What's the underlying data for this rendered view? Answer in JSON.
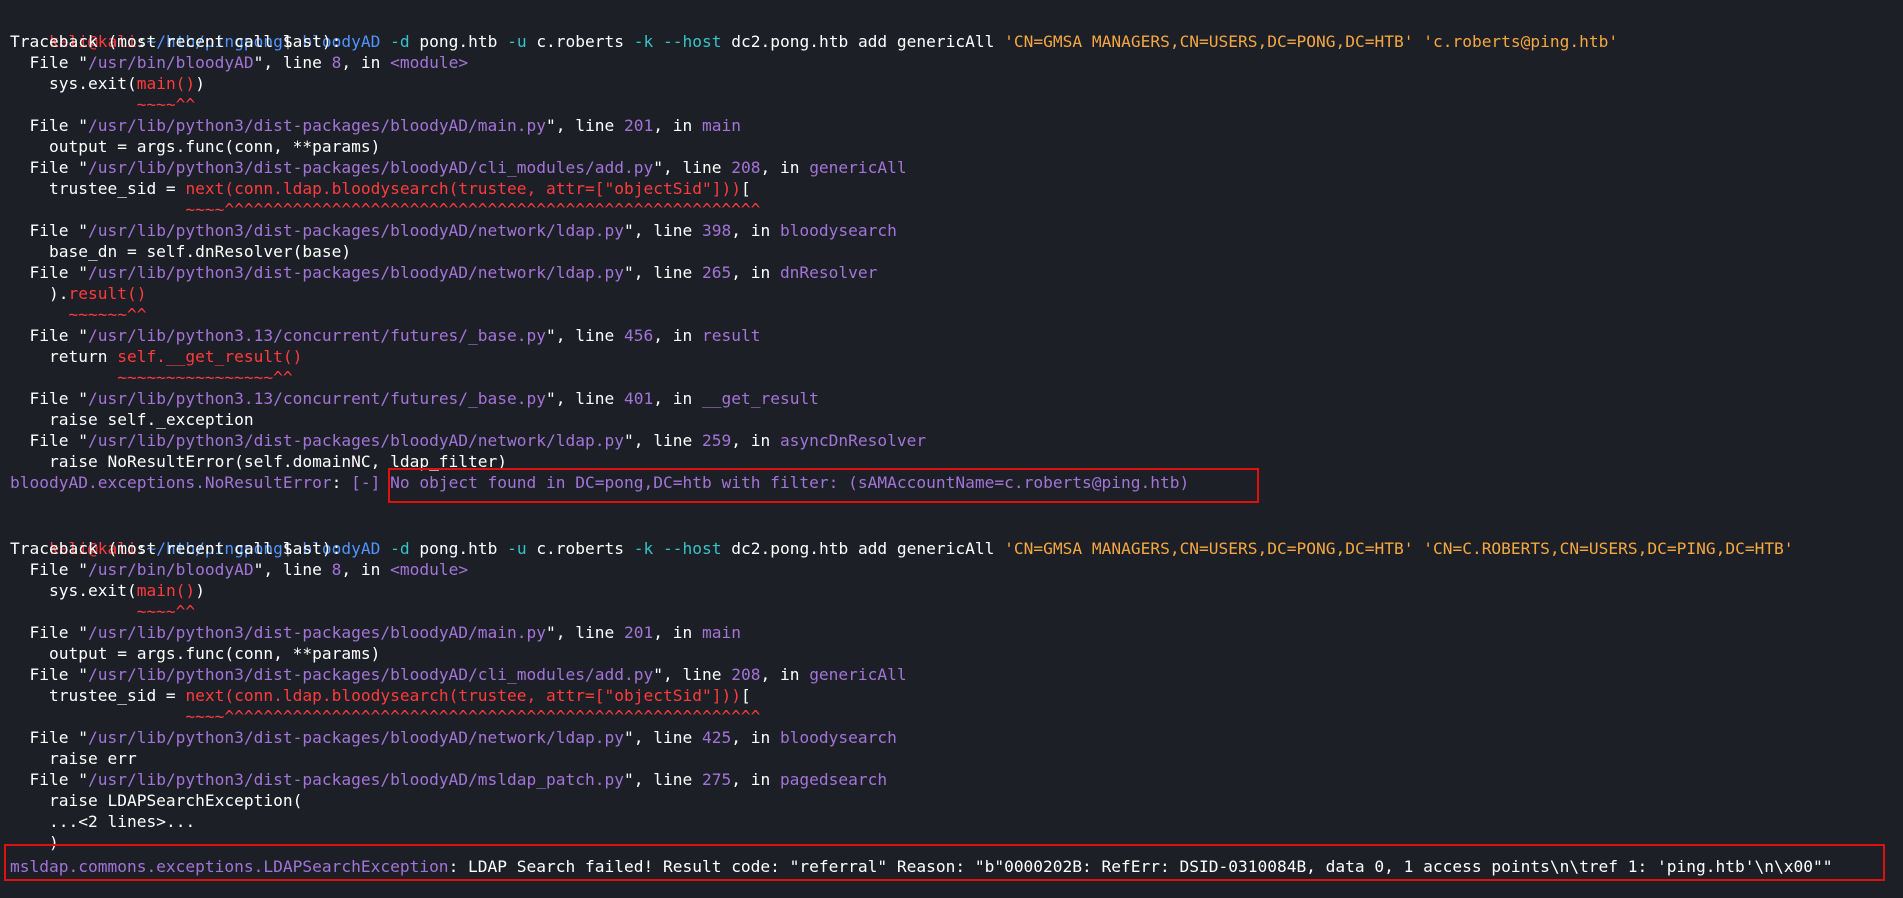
{
  "prompt1": {
    "user": "kali@kali",
    "colon": ":",
    "path": "~/htb/pingpong",
    "sign": "$ "
  },
  "cmd1": {
    "bin": "bloodyAD",
    "a1": " -d ",
    "a1v": "pong.htb",
    "a2": " -u ",
    "a2v": "c.roberts",
    "a3": " -k ",
    "a4": "--host",
    "a4v": " dc2.pong.htb add genericAll ",
    "s1": "'CN=GMSA MANAGERS,CN=USERS,DC=PONG,DC=HTB'",
    "s2": " 'c.roberts@ping.htb'"
  },
  "tb1": [
    "Traceback (most recent call last):"
  ],
  "lines1": {
    "f1a": "  File \"",
    "f1p": "/usr/bin/bloodyAD",
    "f1b": "\", line ",
    "f1n": "8",
    "f1c": ", in ",
    "f1m": "<module>",
    "c1a": "    sys.exit(",
    "c1b": "main()",
    "c1c": ")",
    "u1": "             ~~~~^^",
    "f2a": "  File \"",
    "f2p": "/usr/lib/python3/dist-packages/bloodyAD/main.py",
    "f2b": "\", line ",
    "f2n": "201",
    "f2c": ", in ",
    "f2m": "main",
    "c2": "    output = args.func(conn, **params)",
    "f3a": "  File \"",
    "f3p": "/usr/lib/python3/dist-packages/bloodyAD/cli_modules/add.py",
    "f3b": "\", line ",
    "f3n": "208",
    "f3c": ", in ",
    "f3m": "genericAll",
    "c3a": "    trustee_sid = ",
    "c3b": "next(conn.ldap.bloodysearch(trustee, attr=[\"objectSid\"]))",
    "c3c": "[",
    "u3": "                  ~~~~^^^^^^^^^^^^^^^^^^^^^^^^^^^^^^^^^^^^^^^^^^^^^^^^^^^^^^^",
    "f4a": "  File \"",
    "f4p": "/usr/lib/python3/dist-packages/bloodyAD/network/ldap.py",
    "f4b": "\", line ",
    "f4n": "398",
    "f4c": ", in ",
    "f4m": "bloodysearch",
    "c4": "    base_dn = self.dnResolver(base)",
    "f5a": "  File \"",
    "f5p": "/usr/lib/python3/dist-packages/bloodyAD/network/ldap.py",
    "f5b": "\", line ",
    "f5n": "265",
    "f5c": ", in ",
    "f5m": "dnResolver",
    "c5a": "    ).",
    "c5b": "result()",
    "u5": "      ~~~~~~^^",
    "f6a": "  File \"",
    "f6p": "/usr/lib/python3.13/concurrent/futures/_base.py",
    "f6b": "\", line ",
    "f6n": "456",
    "f6c": ", in ",
    "f6m": "result",
    "c6a": "    return ",
    "c6b": "self.__get_result()",
    "u6": "           ~~~~~~~~~~~~~~~~^^",
    "f7a": "  File \"",
    "f7p": "/usr/lib/python3.13/concurrent/futures/_base.py",
    "f7b": "\", line ",
    "f7n": "401",
    "f7c": ", in ",
    "f7m": "__get_result",
    "c7": "    raise self._exception",
    "f8a": "  File \"",
    "f8p": "/usr/lib/python3/dist-packages/bloodyAD/network/ldap.py",
    "f8b": "\", line ",
    "f8n": "259",
    "f8c": ", in ",
    "f8m": "asyncDnResolver",
    "c8": "    raise NoResultError(self.domainNC, ldap_filter)",
    "e1a": "bloodyAD.exceptions.NoResultError",
    "e1b": ": ",
    "e1c": "[-]",
    "e1d": " No object found in DC=pong,DC=htb with filter: (sAMAccountName=c.roberts@ping.htb)"
  },
  "prompt2": {
    "user": "kali@kali",
    "colon": ":",
    "path": "~/htb/pingpong",
    "sign": "$ "
  },
  "cmd2": {
    "bin": "bloodyAD",
    "a1": " -d ",
    "a1v": "pong.htb",
    "a2": " -u ",
    "a2v": "c.roberts",
    "a3": " -k ",
    "a4": "--host",
    "a4v": " dc2.pong.htb add genericAll ",
    "s1": "'CN=GMSA MANAGERS,CN=USERS,DC=PONG,DC=HTB'",
    "s2": " 'CN=C.ROBERTS,CN=USERS,DC=PING,DC=HTB'"
  },
  "lines2": {
    "tb": "Traceback (most recent call last):",
    "f1a": "  File \"",
    "f1p": "/usr/bin/bloodyAD",
    "f1b": "\", line ",
    "f1n": "8",
    "f1c": ", in ",
    "f1m": "<module>",
    "c1a": "    sys.exit(",
    "c1b": "main()",
    "c1c": ")",
    "u1": "             ~~~~^^",
    "f2a": "  File \"",
    "f2p": "/usr/lib/python3/dist-packages/bloodyAD/main.py",
    "f2b": "\", line ",
    "f2n": "201",
    "f2c": ", in ",
    "f2m": "main",
    "c2": "    output = args.func(conn, **params)",
    "f3a": "  File \"",
    "f3p": "/usr/lib/python3/dist-packages/bloodyAD/cli_modules/add.py",
    "f3b": "\", line ",
    "f3n": "208",
    "f3c": ", in ",
    "f3m": "genericAll",
    "c3a": "    trustee_sid = ",
    "c3b": "next(conn.ldap.bloodysearch(trustee, attr=[\"objectSid\"]))",
    "c3c": "[",
    "u3": "                  ~~~~^^^^^^^^^^^^^^^^^^^^^^^^^^^^^^^^^^^^^^^^^^^^^^^^^^^^^^^",
    "f4a": "  File \"",
    "f4p": "/usr/lib/python3/dist-packages/bloodyAD/network/ldap.py",
    "f4b": "\", line ",
    "f4n": "425",
    "f4c": ", in ",
    "f4m": "bloodysearch",
    "c4": "    raise err",
    "f5a": "  File \"",
    "f5p": "/usr/lib/python3/dist-packages/bloodyAD/msldap_patch.py",
    "f5b": "\", line ",
    "f5n": "275",
    "f5c": ", in ",
    "f5m": "pagedsearch",
    "c5": "    raise LDAPSearchException(",
    "c6a": "    ",
    "c6b": "...",
    "c6c": "<2 lines>",
    "c6d": "...",
    "c7": "    )",
    "e1a": "msldap.commons.exceptions.LDAPSearchException",
    "e1b": ": LDAP Search failed! Result code: \"referral\" Reason: \"b\"0000202B: RefErr: DSID-0310084B, data 0, 1 access points\\n\\tref 1: 'ping.htb'\\n\\x00\"\""
  }
}
